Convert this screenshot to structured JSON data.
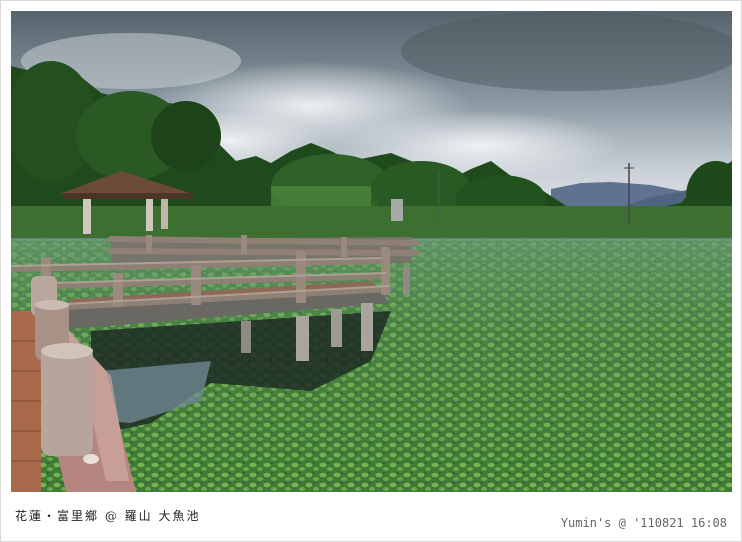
{
  "caption": {
    "location": "花蓮・富里鄉 @ 羅山 大魚池",
    "signature": "Yumin's @ '110821 16:08"
  }
}
